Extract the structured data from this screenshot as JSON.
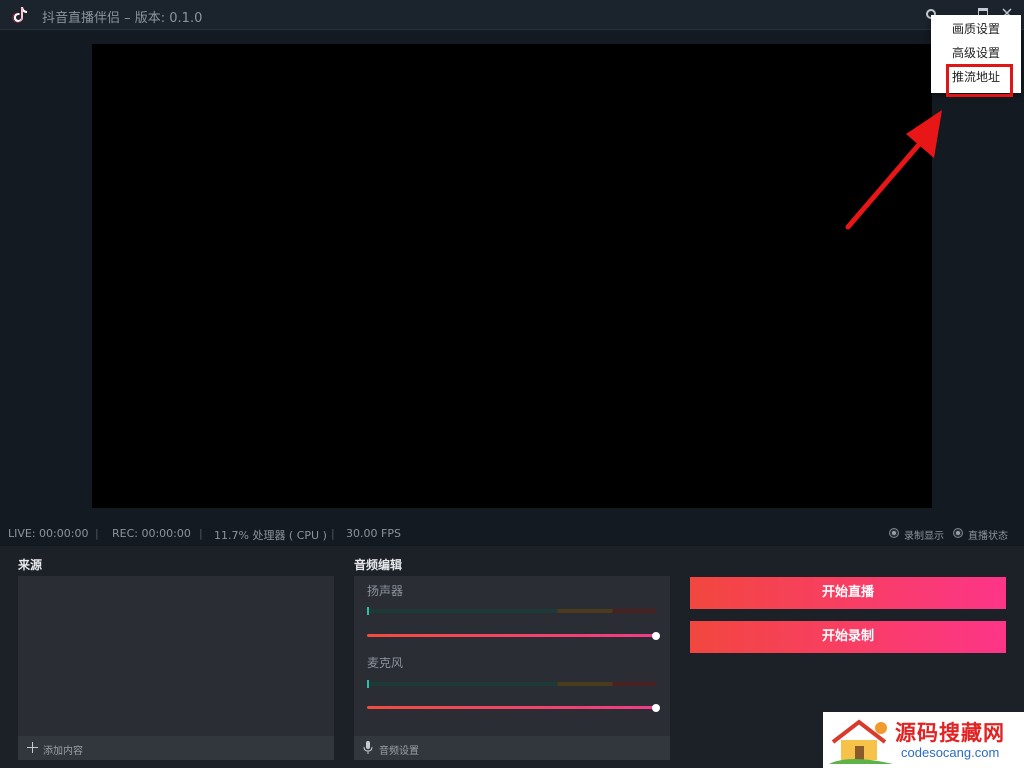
{
  "titlebar": {
    "title": "抖音直播伴侣 – 版本: 0.1.0"
  },
  "menu": {
    "items": [
      "画质设置",
      "高级设置",
      "推流地址"
    ],
    "highlighted_item": "推流地址",
    "highlight_color": "#e01616"
  },
  "statusbar": {
    "live": "LIVE: 00:00:00",
    "rec": "REC: 00:00:00",
    "cpu": "11.7% 处理器 ( CPU )",
    "fps": "30.00 FPS",
    "separator": "|",
    "toggles": [
      "录制显示",
      "直播状态"
    ]
  },
  "sources_panel": {
    "title": "来源",
    "footer_label": "添加内容"
  },
  "audio_panel": {
    "title": "音频编辑",
    "channels": [
      {
        "label": "扬声器",
        "volume_percent": 100
      },
      {
        "label": "麦克风",
        "volume_percent": 100
      }
    ],
    "footer_label": "音频设置"
  },
  "actions": {
    "start_live": "开始直播",
    "start_record": "开始录制",
    "accent_start": "#f2473f",
    "accent_end": "#fd3588"
  },
  "watermark": {
    "title": "源码搜藏网",
    "url": "codesocang.com"
  },
  "icons": [
    "tiktok-logo-icon",
    "gear-icon",
    "minimize-icon",
    "close-icon",
    "plus-icon",
    "microphone-icon",
    "arrow-annotation"
  ]
}
